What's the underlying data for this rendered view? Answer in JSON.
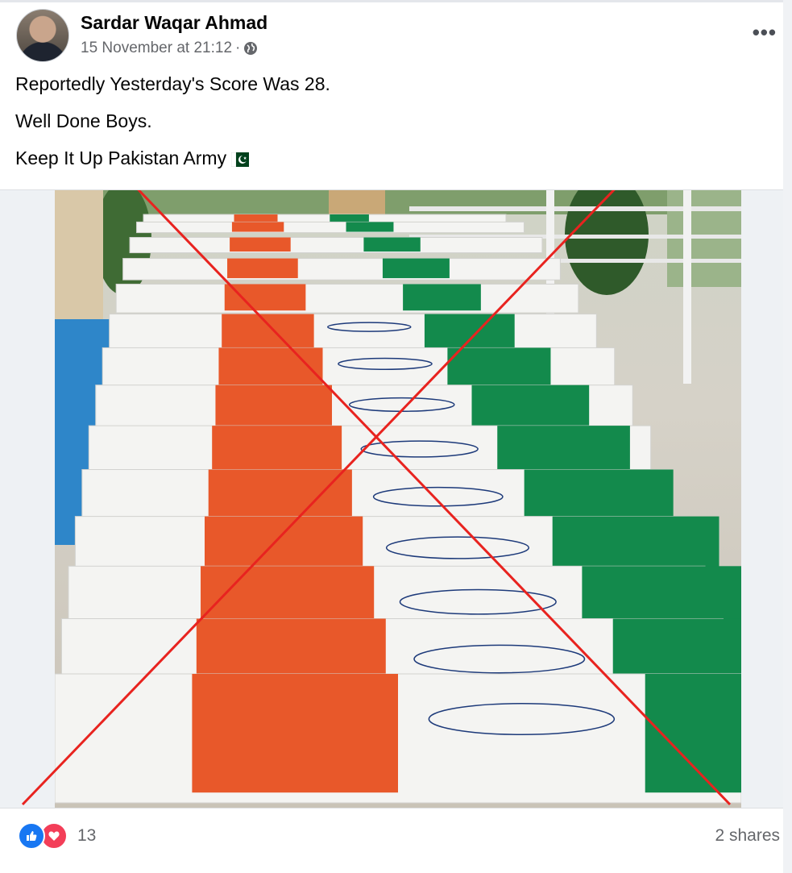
{
  "post": {
    "author": "Sardar Waqar Ahmad",
    "timestamp": "15 November at 21:12",
    "separator": "·",
    "privacy_icon": "globe-icon",
    "more_icon": "•••",
    "lines": [
      "Reportedly Yesterday's Score Was  28.",
      "Well Done Boys.",
      "Keep It Up Pakistan Army"
    ],
    "flag_emoji": "pakistan-flag-icon"
  },
  "footer": {
    "reaction_icons": [
      "like-icon",
      "love-icon"
    ],
    "reaction_count": "13",
    "shares": "2 shares"
  },
  "colors": {
    "fb_blue": "#1877f2",
    "love_red": "#f33e58",
    "cross_red": "#e8231f",
    "saffron": "#e8582a",
    "flag_green": "#138a4c"
  }
}
